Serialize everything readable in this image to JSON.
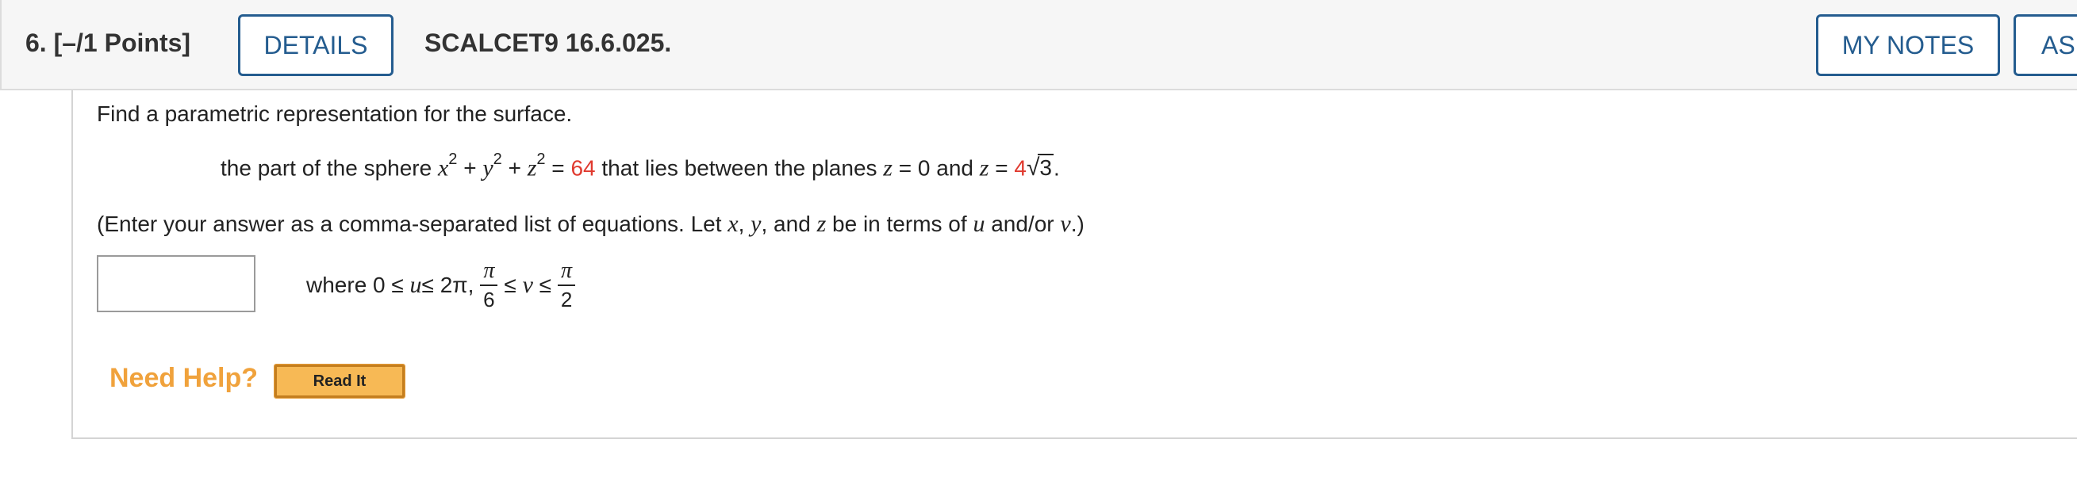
{
  "header": {
    "question_label": "6.  [–/1 Points]",
    "details_button": "DETAILS",
    "problem_code": "SCALCET9 16.6.025.",
    "notes_button": "MY NOTES",
    "ask_button": "ASK"
  },
  "problem": {
    "intro": "Find a parametric representation for the surface.",
    "surface_prefix": "the part of the sphere ",
    "x": "x",
    "y": "y",
    "z": "z",
    "exp": "2",
    "plus": " + ",
    "equals": " = ",
    "radius_sq": "64",
    "surface_mid": " that lies between the planes ",
    "eq_zero": " = 0 and ",
    "coef": "4",
    "sqrt_sign": "√",
    "sqrt_arg": "3",
    "period": ".",
    "instruction_1": "(Enter your answer as a comma-separated list of equations. Let ",
    "sep1": ", ",
    "sep2": ", and ",
    "instruction_2": " be in terms of ",
    "u": "u",
    "and_or": " and/or ",
    "v": "v",
    "instruction_end": ".)"
  },
  "answer": {
    "value": "",
    "where_prefix": "where 0 ≤ ",
    "u": "u",
    "le_2pi": " ≤ 2π,",
    "pi": "π",
    "den_6": "6",
    "le": "≤",
    "v": "v",
    "den_2": "2"
  },
  "help": {
    "label": "Need Help?",
    "read_it": "Read It"
  },
  "colors": {
    "accent": "#245c8f",
    "highlight": "#e03a2f",
    "help": "#f0a23c",
    "button_fill": "#f7b955"
  }
}
